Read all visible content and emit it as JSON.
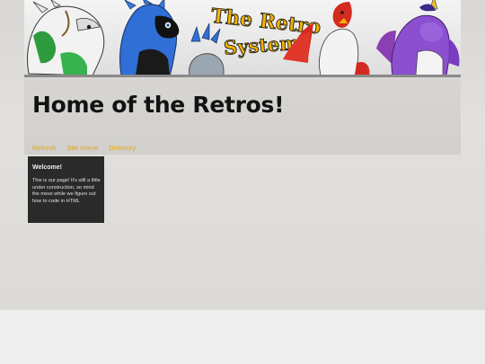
{
  "banner": {
    "logo_line1": "The Retro",
    "logo_line2": "System!"
  },
  "header": {
    "title": "Home of the Retros!"
  },
  "nav": {
    "items": [
      {
        "label": "Refresh"
      },
      {
        "label": "Site Home"
      },
      {
        "label": "Directory"
      }
    ]
  },
  "sidebar": {
    "welcome_title": "Welcome!",
    "welcome_text": "This is our page! It's still a little under construction, so mind the mess while we figure out how to code in HTML"
  },
  "colors": {
    "nav_link": "#e8a600",
    "welcome_bg": "#2a2a2a",
    "title_text": "#121212"
  }
}
